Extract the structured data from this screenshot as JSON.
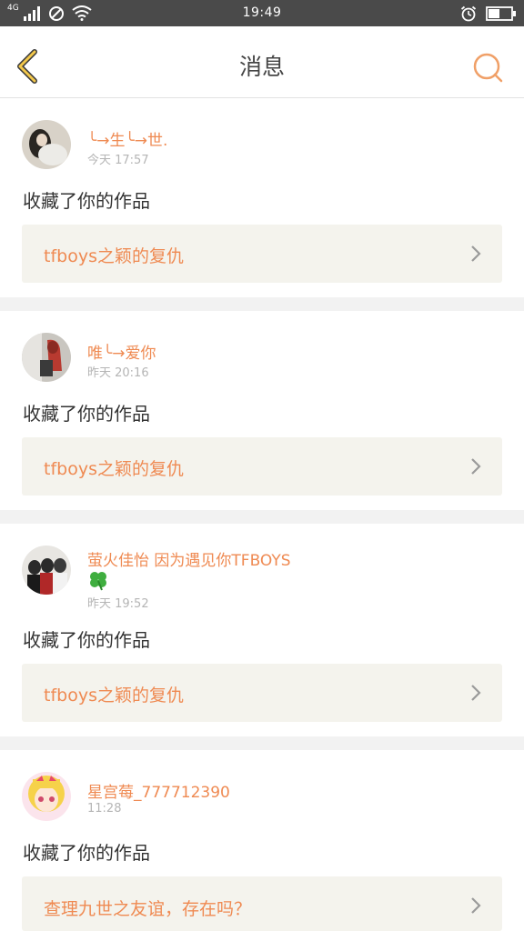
{
  "status_bar": {
    "network": "4G",
    "time": "19:49",
    "icons": [
      "signal-icon",
      "no-sim-icon",
      "wifi-icon",
      "alarm-icon",
      "battery-icon"
    ]
  },
  "header": {
    "title": "消息",
    "back_icon": "chevron-left-icon",
    "search_icon": "search-icon"
  },
  "colors": {
    "accent": "#ef8a52",
    "back_arrow": "#f3c84b",
    "card_bg": "#ffffff",
    "work_bg": "#f4f3ed",
    "page_bg": "#f2f2f2",
    "status_bg": "#4a4a4a"
  },
  "messages": [
    {
      "user": "╰→生╰→世.",
      "time": "今天 17:57",
      "action": "收藏了你的作品",
      "work_title": "tfboys之颖的复仇"
    },
    {
      "user": "唯╰→爱你",
      "time": "昨天 20:16",
      "action": "收藏了你的作品",
      "work_title": "tfboys之颖的复仇"
    },
    {
      "user": "萤火佳怡    因为遇见你TFBOYS",
      "user_extra_icon": "clover-icon",
      "time": "昨天 19:52",
      "action": "收藏了你的作品",
      "work_title": "tfboys之颖的复仇"
    },
    {
      "user": "星宫莓_777712390",
      "time": "11:28",
      "action": "收藏了你的作品",
      "work_title": "查理九世之友谊，存在吗？"
    }
  ]
}
